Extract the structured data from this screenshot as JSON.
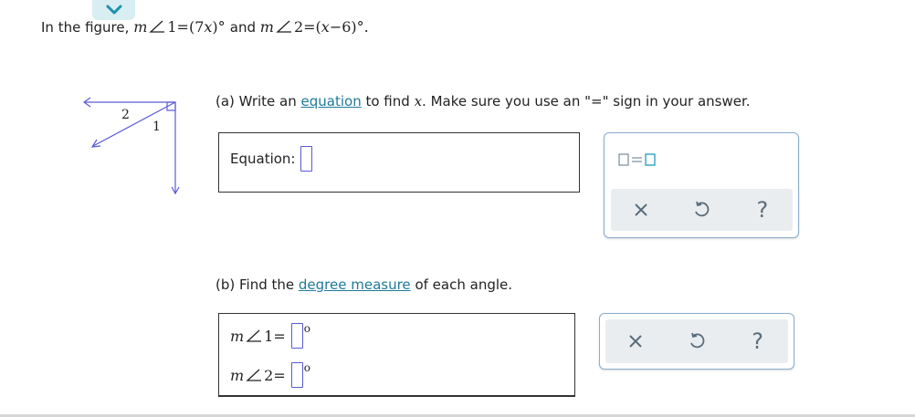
{
  "problem": {
    "intro": "In the figure,",
    "m1": "m",
    "angle1": "1",
    "eq1": "=",
    "expr1_open": "(7",
    "expr1_var": "x",
    "expr1_close": ")°",
    "and": "and",
    "m2": "m",
    "angle2": "2",
    "eq2": "=",
    "expr2_open": "(",
    "expr2_var": "x",
    "expr2_rest": "−6)°."
  },
  "figure": {
    "label2": "2",
    "label1": "1",
    "stroke_color": "#5b5bd6"
  },
  "part_a": {
    "prefix": "(a)  Write an",
    "link": "equation",
    "mid": "to find",
    "var": "x",
    "suffix": ". Make sure you use an \"=\" sign in your answer.",
    "equation_label": "Equation:",
    "equation_value": ""
  },
  "part_b": {
    "prefix": "(b)  Find the",
    "link": "degree measure",
    "suffix": "of each angle.",
    "row1_m": "m",
    "row1_angle": "1",
    "row1_eq": "=",
    "row2_m": "m",
    "row2_angle": "2",
    "row2_eq": "=",
    "degree": "o"
  },
  "palette": {
    "template_icon": "box-equals-box-icon",
    "clear_icon": "x-icon",
    "undo_icon": "undo-icon",
    "help_label": "?"
  },
  "colors": {
    "link": "#1f7a99",
    "input_border": "#5a5ad6",
    "palette_border": "#8aaecf",
    "toolbar_bg": "#e9edf0"
  }
}
